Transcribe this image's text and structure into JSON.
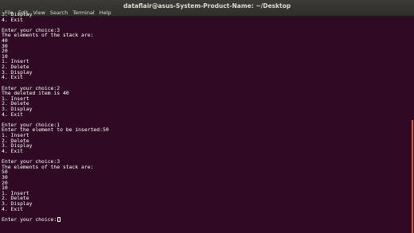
{
  "window": {
    "title": "dataflair@asus-System-Product-Name: ~/Desktop"
  },
  "menu": {
    "items": [
      "File",
      "Edit",
      "View",
      "Search",
      "Terminal",
      "Help"
    ]
  },
  "terminal": {
    "lines": [
      "3. Display",
      "4. Exit",
      "",
      "Enter your choice:3",
      "The elements of the stack are:",
      "40",
      "30",
      "20",
      "10",
      "1. Insert",
      "2. Delete",
      "3. Display",
      "4. Exit",
      "",
      "Enter your choice:2",
      "The deleted item is 40",
      "1. Insert",
      "2. Delete",
      "3. Display",
      "4. Exit",
      "",
      "Enter your choice:1",
      "Enter the element to be inserted:50",
      "1. Insert",
      "2. Delete",
      "3. Display",
      "4. Exit",
      "",
      "Enter your choice:3",
      "The elements of the stack are:",
      "50",
      "30",
      "20",
      "10",
      "1. Insert",
      "2. Delete",
      "3. Display",
      "4. Exit",
      "",
      "Enter your choice:"
    ]
  },
  "colors": {
    "terminal_background": "#300a24",
    "text": "#ffffff",
    "scrollbar_accent": "#e95420"
  }
}
